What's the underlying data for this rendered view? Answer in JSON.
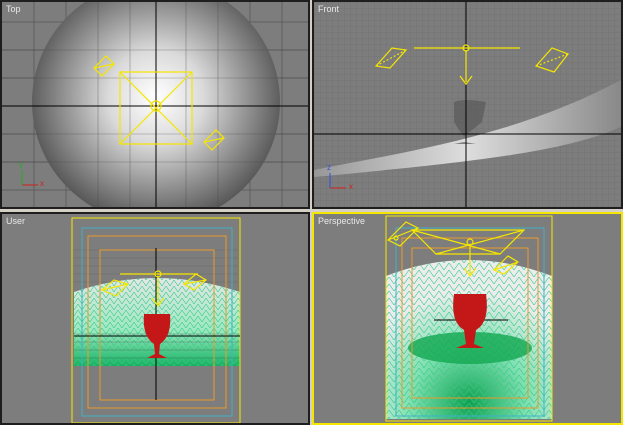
{
  "viewports": {
    "top": {
      "label": "Top"
    },
    "front": {
      "label": "Front"
    },
    "user": {
      "label": "User"
    },
    "perspective": {
      "label": "Perspective"
    }
  },
  "axes": {
    "x": "x",
    "y": "y",
    "z": "z"
  },
  "active_viewport": "perspective",
  "colors": {
    "viewport_bg": "#7d7d7d",
    "active_border": "#f5e600",
    "light_gizmo": "#f5e600",
    "wine_glass": "#c41818",
    "mesh_wire": "#2ecc8a",
    "safe_frame_cyan": "#3fb0c8",
    "safe_frame_orange": "#e89a2c"
  }
}
